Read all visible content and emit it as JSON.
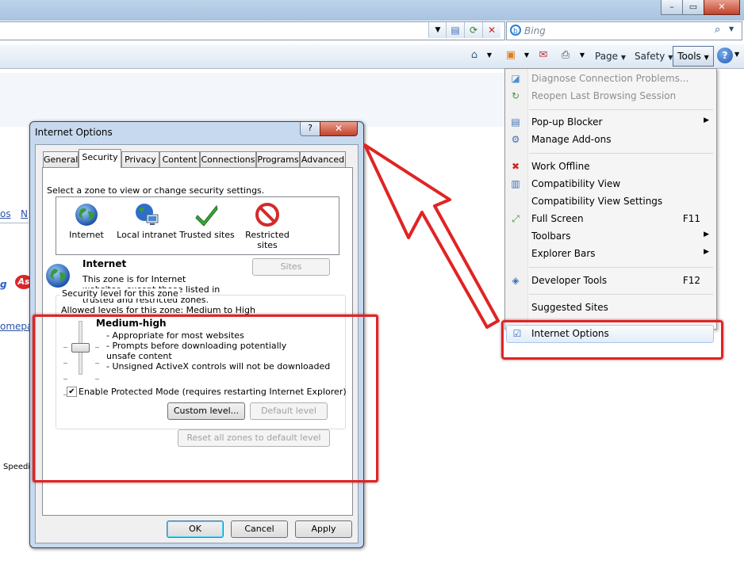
{
  "browser": {
    "search_placeholder": "Bing",
    "commands": {
      "page": "Page",
      "safety": "Safety",
      "tools": "Tools",
      "help_glyph": "?"
    },
    "window_buttons": [
      "–",
      "▭",
      "✕"
    ]
  },
  "background_page": {
    "frag_links": [
      "os",
      "N"
    ],
    "frag_logo": "As",
    "frag_homepage": "omepa",
    "frag_speed": "Speedi"
  },
  "tools_menu": {
    "items": [
      {
        "label": "Diagnose Connection Problems...",
        "enabled": false,
        "icon": "diagnose-icon"
      },
      {
        "label": "Reopen Last Browsing Session",
        "enabled": false,
        "icon": "reopen-icon"
      },
      {
        "label": "Pop-up Blocker",
        "submenu": true,
        "icon": "popup-blocker-icon"
      },
      {
        "label": "Manage Add-ons",
        "icon": "addons-icon"
      },
      {
        "label": "Work Offline",
        "icon": "work-offline-icon"
      },
      {
        "label": "Compatibility View",
        "icon": "compat-view-icon"
      },
      {
        "label": "Compatibility View Settings"
      },
      {
        "label": "Full Screen",
        "accelerator": "F11",
        "icon": "fullscreen-icon"
      },
      {
        "label": "Toolbars",
        "submenu": true
      },
      {
        "label": "Explorer Bars",
        "submenu": true
      },
      {
        "label": "Developer Tools",
        "accelerator": "F12",
        "icon": "devtools-icon"
      },
      {
        "label": "Suggested Sites"
      },
      {
        "label": "Internet Options",
        "icon": "internet-options-icon",
        "highlighted": true
      }
    ]
  },
  "dialog": {
    "title": "Internet Options",
    "help_glyph": "?",
    "close_glyph": "✕",
    "tabs": [
      "General",
      "Security",
      "Privacy",
      "Content",
      "Connections",
      "Programs",
      "Advanced"
    ],
    "active_tab": "Security",
    "zone_prompt": "Select a zone to view or change security settings.",
    "zones": [
      {
        "label": "Internet",
        "icon": "globe-icon"
      },
      {
        "label": "Local intranet",
        "icon": "intranet-icon"
      },
      {
        "label": "Trusted sites",
        "icon": "checkmark-icon"
      },
      {
        "label": "Restricted sites",
        "icon": "restricted-icon"
      }
    ],
    "selected_zone": {
      "name": "Internet",
      "description": "This zone is for Internet websites, except those listed in trusted and restricted zones."
    },
    "sites_button": "Sites",
    "security_level": {
      "group_label": "Security level for this zone",
      "allowed": "Allowed levels for this zone: Medium to High",
      "level_name": "Medium-high",
      "details": [
        "- Appropriate for most websites",
        "- Prompts before downloading potentially unsafe content",
        "- Unsigned ActiveX controls will not be downloaded"
      ]
    },
    "protected_mode": {
      "label": "Enable Protected Mode (requires restarting Internet Explorer)",
      "checked": true
    },
    "custom_level_button": "Custom level...",
    "default_level_button": "Default level",
    "reset_all_button": "Reset all zones to default level",
    "ok_button": "OK",
    "cancel_button": "Cancel",
    "apply_button": "Apply"
  },
  "colors": {
    "annotation_red": "#e02424",
    "chrome_blue": "#c7d9ee"
  }
}
